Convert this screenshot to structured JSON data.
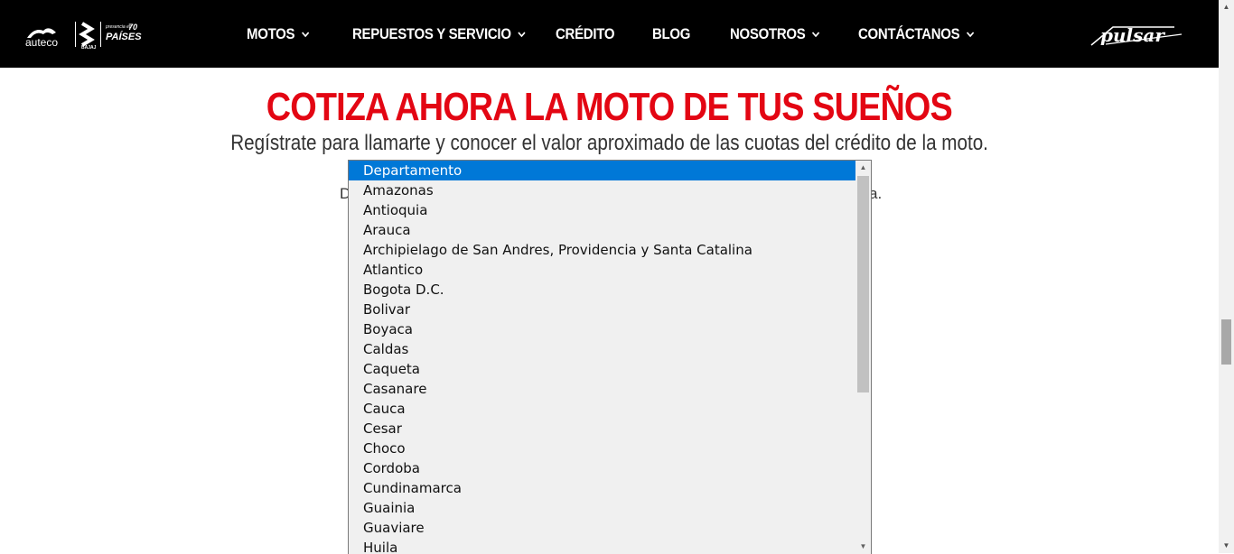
{
  "nav": {
    "brand": {
      "auteco": "auteco",
      "bajaj": "BAJAJ",
      "presencia": "presencia en",
      "number": "70",
      "paises": "PAÍSES"
    },
    "items": [
      {
        "label": "MOTOS",
        "has_dropdown": true
      },
      {
        "label": "REPUESTOS Y SERVICIO",
        "has_dropdown": true
      },
      {
        "label": "CRÉDITO",
        "has_dropdown": false
      },
      {
        "label": "BLOG",
        "has_dropdown": false
      },
      {
        "label": "NOSOTROS",
        "has_dropdown": true
      },
      {
        "label": "CONTÁCTANOS",
        "has_dropdown": true
      }
    ],
    "pulsar_logo": "pulsar"
  },
  "hero": {
    "title": "COTIZA AHORA LA MOTO DE TUS SUEÑOS",
    "subtitle": "Regístrate para llamarte y conocer el valor aproximado de las cuotas del crédito de la moto.",
    "behind_left": "D",
    "behind_right": "a."
  },
  "dropdown": {
    "selected": "Departamento",
    "options": [
      "Departamento",
      "Amazonas",
      "Antioquia",
      "Arauca",
      "Archipielago de San Andres, Providencia y Santa Catalina",
      "Atlantico",
      "Bogota D.C.",
      "Bolivar",
      "Boyaca",
      "Caldas",
      "Caqueta",
      "Casanare",
      "Cauca",
      "Cesar",
      "Choco",
      "Cordoba",
      "Cundinamarca",
      "Guainia",
      "Guaviare",
      "Huila"
    ]
  },
  "colors": {
    "title_red": "#e30613",
    "nav_bg": "#000000",
    "selection": "#0078d7"
  }
}
